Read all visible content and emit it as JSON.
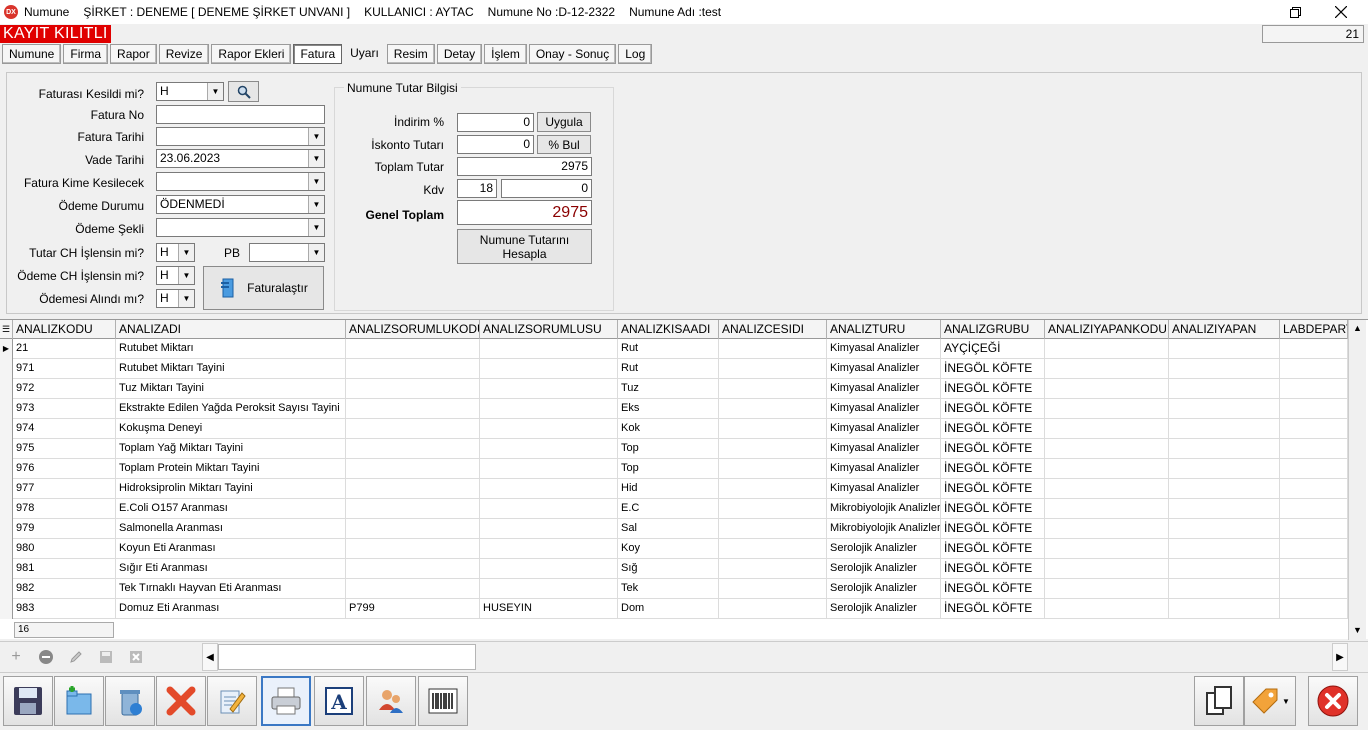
{
  "titlebar": {
    "app_name": "Numune",
    "company": "ŞİRKET : DENEME [ DENEME ŞİRKET UNVANI ]",
    "user": "KULLANICI : AYTAC",
    "sample_no": "Numune No :D-12-2322",
    "sample_name": "Numune Adı :test"
  },
  "status": {
    "locked": "KAYIT KILITLI",
    "counter": "21"
  },
  "tabs": [
    "Numune",
    "Firma",
    "Rapor",
    "Revize",
    "Rapor Ekleri",
    "Fatura",
    "Uyarı",
    "Resim",
    "Detay",
    "İşlem",
    "Onay - Sonuç",
    "Log"
  ],
  "active_tab": "Fatura",
  "invoice_form": {
    "faturasi_kesildi_label": "Faturası Kesildi mi?",
    "faturasi_kesildi_value": "H",
    "fatura_no_label": "Fatura No",
    "fatura_no_value": "",
    "fatura_tarihi_label": "Fatura Tarihi",
    "fatura_tarihi_value": "",
    "vade_tarihi_label": "Vade Tarihi",
    "vade_tarihi_value": "23.06.2023",
    "fatura_kime_label": "Fatura Kime Kesilecek",
    "fatura_kime_value": "",
    "odeme_durumu_label": "Ödeme Durumu",
    "odeme_durumu_value": "ÖDENMEDİ",
    "odeme_sekli_label": "Ödeme Şekli",
    "odeme_sekli_value": "",
    "tutar_ch_label": "Tutar CH İşlensin mi?",
    "tutar_ch_value": "H",
    "pb_label": "PB",
    "pb_value": "",
    "odeme_ch_label": "Ödeme CH İşlensin mi?",
    "odeme_ch_value": "H",
    "odemesi_alindi_label": "Ödemesi Alındı mı?",
    "odemesi_alindi_value": "H",
    "faturalastir_label": "Faturalaştır"
  },
  "amount_box": {
    "title": "Numune Tutar Bilgisi",
    "indirim_label": "İndirim %",
    "indirim_value": "0",
    "uygula_label": "Uygula",
    "iskonto_label": "İskonto Tutarı",
    "iskonto_value": "0",
    "bul_label": "% Bul",
    "toplam_label": "Toplam Tutar",
    "toplam_value": "2975",
    "kdv_label": "Kdv",
    "kdv_rate": "18",
    "kdv_value": "0",
    "genel_label": "Genel Toplam",
    "genel_value": "2975",
    "hesapla_label": "Numune Tutarını Hesapla"
  },
  "grid": {
    "columns": [
      "ANALIZKODU",
      "ANALIZADI",
      "ANALIZSORUMLUKODU",
      "ANALIZSORUMLUSU",
      "ANALIZKISAADI",
      "ANALIZCESIDI",
      "ANALIZTURU",
      "ANALIZGRUBU",
      "ANALIZIYAPANKODU",
      "ANALIZIYAPAN",
      "LABDEPARTI"
    ],
    "rows": [
      [
        "21",
        "Rutubet Miktarı",
        "",
        "",
        "Rut",
        "",
        "Kimyasal Analizler",
        "AYÇİÇEĞİ",
        "",
        "",
        ""
      ],
      [
        "971",
        "Rutubet Miktarı Tayini",
        "",
        "",
        "Rut",
        "",
        "Kimyasal Analizler",
        "İNEGÖL KÖFTE",
        "",
        "",
        ""
      ],
      [
        "972",
        "Tuz Miktarı Tayini",
        "",
        "",
        "Tuz",
        "",
        "Kimyasal Analizler",
        "İNEGÖL KÖFTE",
        "",
        "",
        ""
      ],
      [
        "973",
        "Ekstrakte Edilen Yağda Peroksit Sayısı Tayini",
        "",
        "",
        "Eks",
        "",
        "Kimyasal Analizler",
        "İNEGÖL KÖFTE",
        "",
        "",
        ""
      ],
      [
        "974",
        "Kokuşma Deneyi",
        "",
        "",
        "Kok",
        "",
        "Kimyasal Analizler",
        "İNEGÖL KÖFTE",
        "",
        "",
        ""
      ],
      [
        "975",
        "Toplam Yağ Miktarı Tayini",
        "",
        "",
        "Top",
        "",
        "Kimyasal Analizler",
        "İNEGÖL KÖFTE",
        "",
        "",
        ""
      ],
      [
        "976",
        "Toplam Protein Miktarı Tayini",
        "",
        "",
        "Top",
        "",
        "Kimyasal Analizler",
        "İNEGÖL KÖFTE",
        "",
        "",
        ""
      ],
      [
        "977",
        "Hidroksiprolin Miktarı Tayini",
        "",
        "",
        "Hid",
        "",
        "Kimyasal Analizler",
        "İNEGÖL KÖFTE",
        "",
        "",
        ""
      ],
      [
        "978",
        "E.Coli O157 Aranması",
        "",
        "",
        "E.C",
        "",
        "Mikrobiyolojik Analizler",
        "İNEGÖL KÖFTE",
        "",
        "",
        ""
      ],
      [
        "979",
        "Salmonella Aranması",
        "",
        "",
        "Sal",
        "",
        "Mikrobiyolojik Analizler",
        "İNEGÖL KÖFTE",
        "",
        "",
        ""
      ],
      [
        "980",
        "Koyun Eti Aranması",
        "",
        "",
        "Koy",
        "",
        "Serolojik Analizler",
        "İNEGÖL KÖFTE",
        "",
        "",
        ""
      ],
      [
        "981",
        "Sığır Eti Aranması",
        "",
        "",
        "Sığ",
        "",
        "Serolojik Analizler",
        "İNEGÖL KÖFTE",
        "",
        "",
        ""
      ],
      [
        "982",
        "Tek Tırnaklı Hayvan Eti Aranması",
        "",
        "",
        "Tek",
        "",
        "Serolojik Analizler",
        "İNEGÖL KÖFTE",
        "",
        "",
        ""
      ],
      [
        "983",
        "Domuz Eti Aranması",
        "P799",
        "HUSEYIN",
        "Dom",
        "",
        "Serolojik Analizler",
        "İNEGÖL KÖFTE",
        "",
        "",
        ""
      ]
    ],
    "footer_count": "16"
  },
  "colors": {
    "locked_bg": "#e00000",
    "total_text": "#8b0000",
    "selected_border": "#3b78c4"
  }
}
